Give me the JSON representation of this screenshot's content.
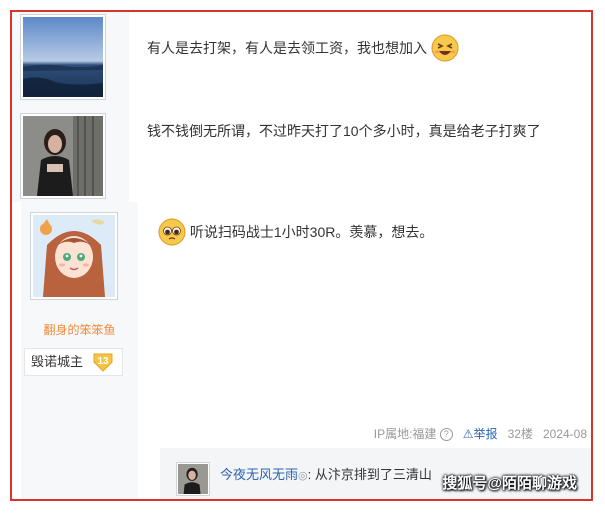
{
  "posts": [
    {
      "text": "有人是去打架，有人是去领工资，我也想加入",
      "emoji": "grin-squint-emoji"
    },
    {
      "text": "钱不钱倒无所谓，不过昨天打了10个多小时，真是给老子打爽了"
    },
    {
      "text": "听说扫码战士1小时30R。羡慕，想去。",
      "emoji": "pleading-face-emoji"
    }
  ],
  "user": {
    "name": "翻身的笨笨鱼",
    "badge_title": "毁诺城主",
    "badge_level": "13"
  },
  "meta": {
    "ip_label": "IP属地:福建",
    "report_label": "举报",
    "floor": "32楼",
    "date": "2024-08"
  },
  "reply": {
    "author": "今夜无风无雨",
    "suffix": ": 从汴京排到了三清山"
  },
  "watermark": "搜狐号@陌陌聊游戏",
  "colors": {
    "frame": "#d9342b",
    "username": "#f08a3c",
    "link": "#2d64b3"
  }
}
